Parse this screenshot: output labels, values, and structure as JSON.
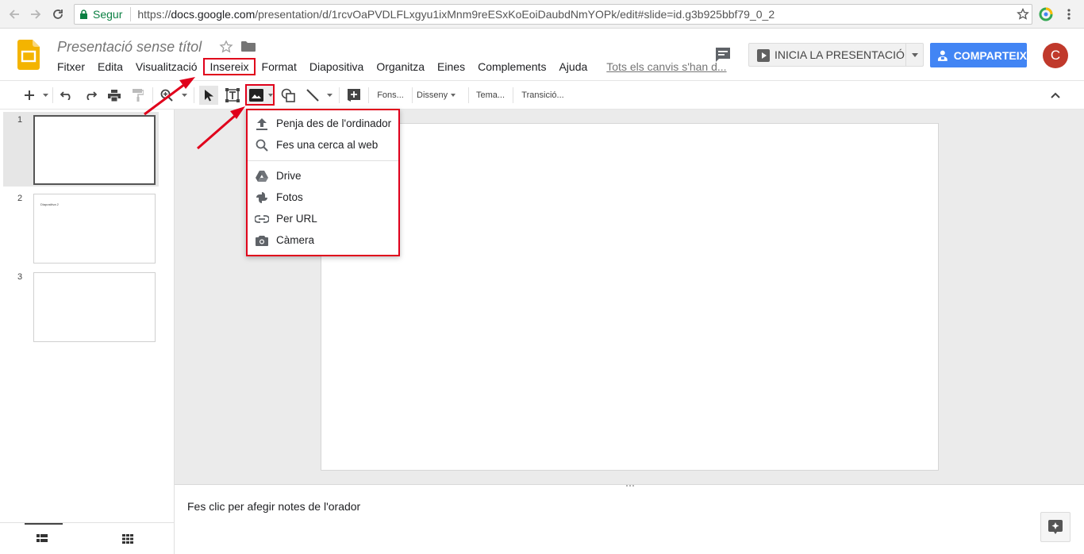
{
  "browser": {
    "secure_label": "Segur",
    "url_prefix": "https://",
    "url_host": "docs.google.com",
    "url_path": "/presentation/d/1rcvOaPVDLFLxgyu1ixMnm9reESxKoEoiDaubdNmYOPk/edit#slide=id.g3b925bbf79_0_2"
  },
  "doc": {
    "title": "Presentació sense títol"
  },
  "menu": {
    "items": [
      "Fitxer",
      "Edita",
      "Visualització",
      "Insereix",
      "Format",
      "Diapositiva",
      "Organitza",
      "Eines",
      "Complements",
      "Ajuda"
    ],
    "saved_status": "Tots els canvis s'han d..."
  },
  "header": {
    "present_label": "INICIA LA PRESENTACIÓ",
    "share_label": "COMPARTEIX",
    "avatar_initial": "C"
  },
  "toolbar": {
    "background_label": "Fons...",
    "layout_label": "Disseny",
    "theme_label": "Tema...",
    "transition_label": "Transició..."
  },
  "filmstrip": {
    "slides": [
      {
        "number": "1",
        "text": ""
      },
      {
        "number": "2",
        "text": "Diapositiva 2"
      },
      {
        "number": "3",
        "text": ""
      }
    ]
  },
  "image_menu": {
    "items": [
      {
        "label": "Penja des de l'ordinador",
        "icon": "upload-icon"
      },
      {
        "label": "Fes una cerca al web",
        "icon": "search-icon"
      },
      {
        "label": "Drive",
        "icon": "drive-icon"
      },
      {
        "label": "Fotos",
        "icon": "photos-icon"
      },
      {
        "label": "Per URL",
        "icon": "link-icon"
      },
      {
        "label": "Càmera",
        "icon": "camera-icon"
      }
    ]
  },
  "notes": {
    "placeholder": "Fes clic per afegir notes de l'orador"
  },
  "colors": {
    "highlight": "#e0001b",
    "share_button": "#4285f4",
    "avatar": "#c0392b",
    "logo": "#f4b400"
  }
}
